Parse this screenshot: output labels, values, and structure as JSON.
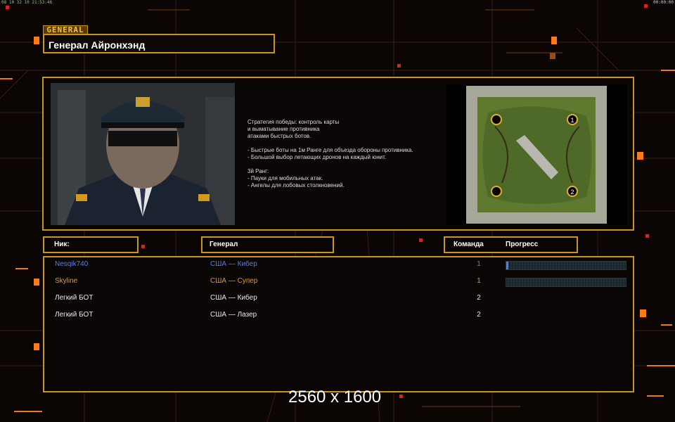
{
  "hud": {
    "top_left": "08 10 32 10 21:53:46",
    "top_right": "00:00:00"
  },
  "colors": {
    "accent": "#c9951a",
    "player_blue": "#5a7fdf",
    "player_orange": "#e39a28",
    "neutral": "#e0e0e0"
  },
  "general": {
    "tag": "GENERAL",
    "name": "Генерал Айронхэнд",
    "portrait_icon": "officer-portrait",
    "description": "Стратегия победы: контроль карты\nи выматывание противника\nатаками быстрых ботов.\n\n- Быстрые боты на 1м Ранге для объезда обороны противника.\n- Большой выбор летающих дронов на каждый юнит.\n\n3й Ранг:\n- Пауки для мобильных атак.\n- Ангелы для лобовых столкновений."
  },
  "minimap": {
    "icon": "map-preview",
    "start_markers": [
      "1",
      "2"
    ]
  },
  "table": {
    "headers": {
      "nick": "Ник:",
      "general": "Генерал",
      "team": "Команда",
      "progress": "Прогресс"
    },
    "rows": [
      {
        "nick": "Nesqik740",
        "general": "США — Кибер",
        "team": "1",
        "progress": 0.02,
        "color": "#5a7fdf"
      },
      {
        "nick": "Skyline",
        "general": "США — Супер",
        "team": "1",
        "progress": 0.0,
        "color": "#e39a28"
      },
      {
        "nick": "Легкий БОТ",
        "general": "США — Кибер",
        "team": "2",
        "color": "#e0e0e0"
      },
      {
        "nick": "Легкий БОТ",
        "general": "США — Лазер",
        "team": "2",
        "color": "#e0e0e0"
      }
    ]
  },
  "resolution_text": "2560 x 1600"
}
